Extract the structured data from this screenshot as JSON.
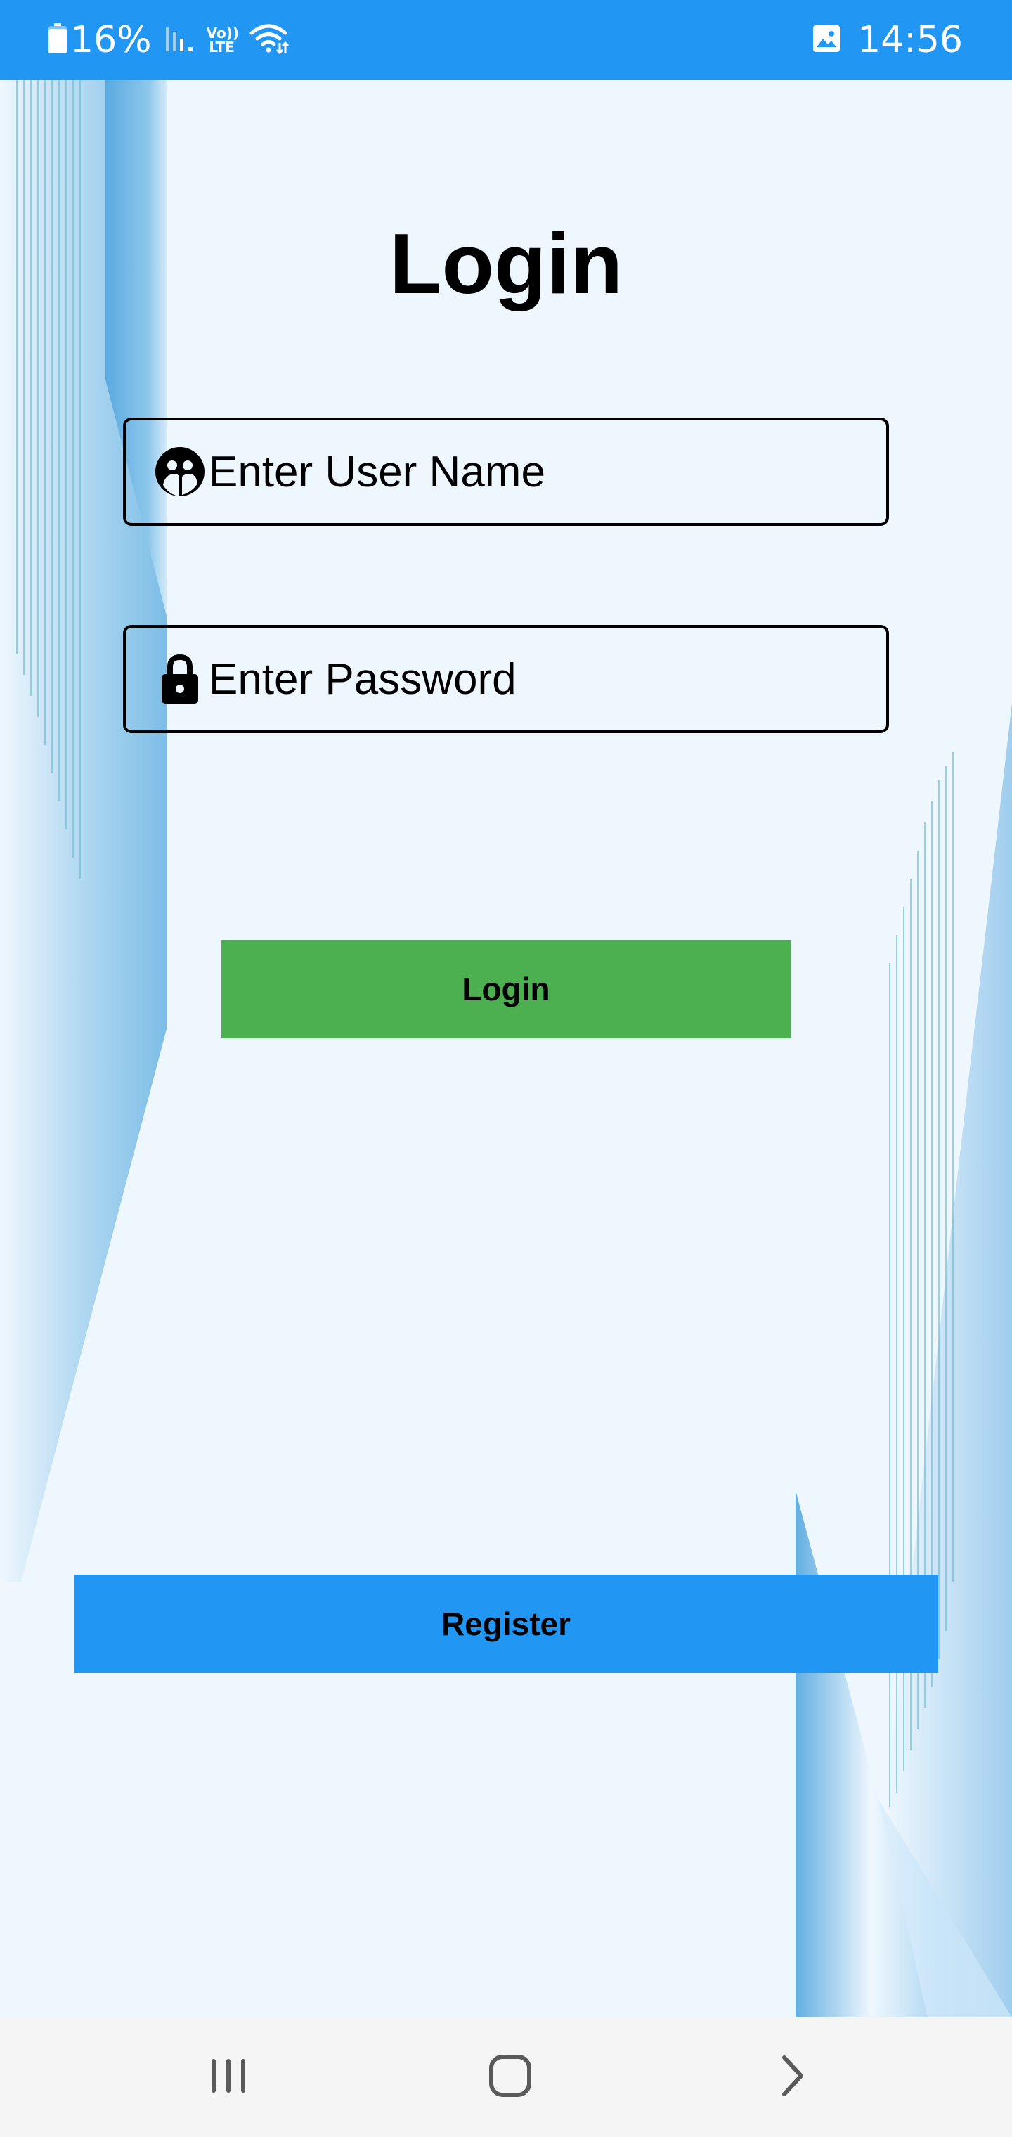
{
  "status_bar": {
    "battery_text": "16%",
    "volte_top": "Vo))",
    "volte_bottom": "LTE",
    "time": "14:56",
    "icons": [
      "battery-icon",
      "signal-icon",
      "volte-icon",
      "wifi-icon",
      "gallery-icon"
    ]
  },
  "colors": {
    "status_bar": "#2196f3",
    "background": "#eff7fe",
    "login_button": "#4caf50",
    "register_button": "#2196f3",
    "decoration_blue": "#5aaae0"
  },
  "login": {
    "title": "Login",
    "username_placeholder": "Enter User Name",
    "username_icon": "user-circle-icon",
    "password_placeholder": "Enter Password",
    "password_icon": "lock-icon",
    "login_button": "Login",
    "register_button": "Register"
  },
  "nav_bar": {
    "items": [
      "recents-icon",
      "home-icon",
      "back-icon"
    ]
  }
}
